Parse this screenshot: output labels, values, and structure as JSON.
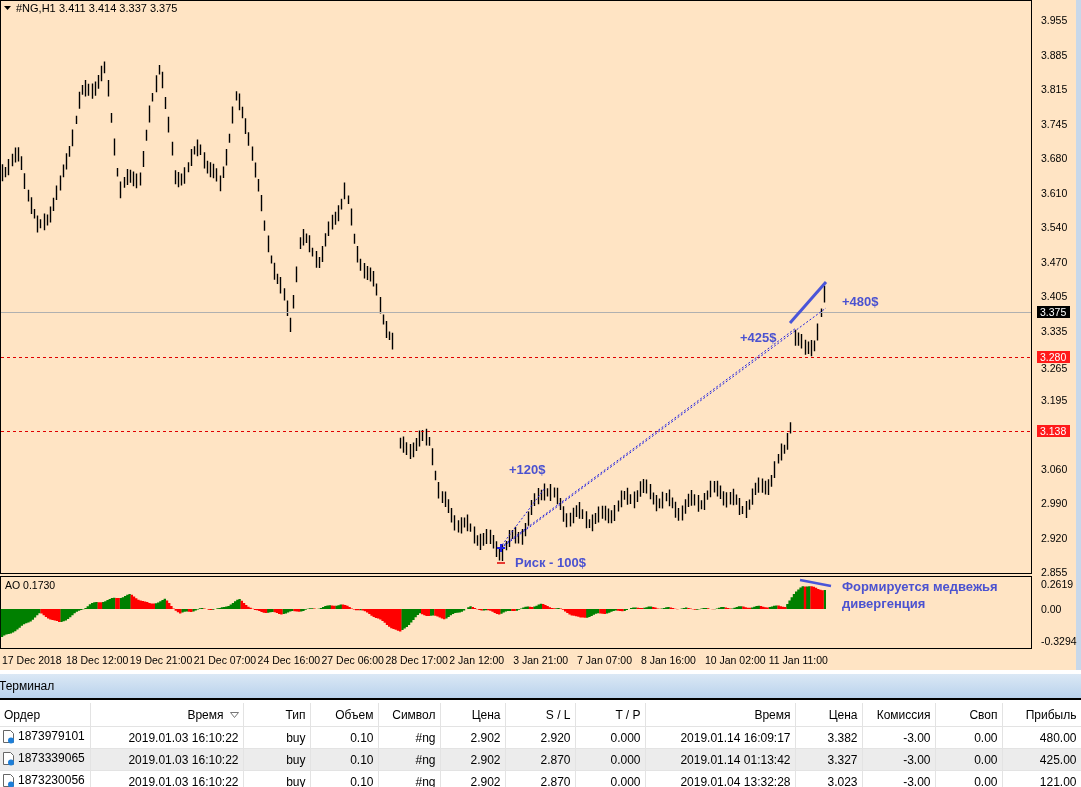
{
  "chart": {
    "symbol": "#NG,H1",
    "ohlc": "3.411 3.414 3.337 3.375",
    "price_axis": [
      "3.955",
      "3.885",
      "3.815",
      "3.745",
      "3.680",
      "3.610",
      "3.540",
      "3.470",
      "3.405",
      "3.335",
      "3.265",
      "3.195",
      "3.060",
      "2.990",
      "2.920",
      "2.855"
    ],
    "price_markers": [
      {
        "text": "3.375",
        "kind": "current"
      },
      {
        "text": "3.280",
        "kind": "level"
      },
      {
        "text": "3.138",
        "kind": "level"
      }
    ],
    "annotations": [
      "+120$",
      "Риск - 100$",
      "+425$",
      "+480$"
    ],
    "indicator": {
      "label": "AO 0.1730",
      "axis": [
        "0.2619",
        "0.00",
        "-0.3294"
      ],
      "note": "Формируется медвежья дивергенция"
    },
    "time_axis": [
      "17 Dec 2018",
      "18 Dec 12:00",
      "19 Dec 21:00",
      "21 Dec 07:00",
      "24 Dec 16:00",
      "27 Dec 06:00",
      "28 Dec 17:00",
      "2 Jan 12:00",
      "3 Jan 21:00",
      "7 Jan 07:00",
      "8 Jan 16:00",
      "10 Jan 02:00",
      "11 Jan 11:00"
    ]
  },
  "terminal": {
    "title": "Терминал",
    "columns": [
      {
        "label": "Ордер",
        "sorted": false
      },
      {
        "label": "Время",
        "sorted": true
      },
      {
        "label": "Тип",
        "sorted": false
      },
      {
        "label": "Объем",
        "sorted": false
      },
      {
        "label": "Символ",
        "sorted": false
      },
      {
        "label": "Цена",
        "sorted": false
      },
      {
        "label": "S / L",
        "sorted": false
      },
      {
        "label": "T / P",
        "sorted": false
      },
      {
        "label": "Время",
        "sorted": false
      },
      {
        "label": "Цена",
        "sorted": false
      },
      {
        "label": "Комиссия",
        "sorted": false
      },
      {
        "label": "Своп",
        "sorted": false
      },
      {
        "label": "Прибыль",
        "sorted": false
      }
    ],
    "rows": [
      [
        "1873979101",
        "2019.01.03 16:10:22",
        "buy",
        "0.10",
        "#ng",
        "2.902",
        "2.920",
        "0.000",
        "2019.01.14 16:09:17",
        "3.382",
        "-3.00",
        "0.00",
        "480.00"
      ],
      [
        "1873339065",
        "2019.01.03 16:10:22",
        "buy",
        "0.10",
        "#ng",
        "2.902",
        "2.870",
        "0.000",
        "2019.01.14 01:13:42",
        "3.327",
        "-3.00",
        "0.00",
        "425.00"
      ],
      [
        "1873230056",
        "2019.01.03 16:10:22",
        "buy",
        "0.10",
        "#ng",
        "2.902",
        "2.870",
        "0.000",
        "2019.01.04 13:32:28",
        "3.023",
        "-3.00",
        "0.00",
        "121.00"
      ]
    ]
  }
}
